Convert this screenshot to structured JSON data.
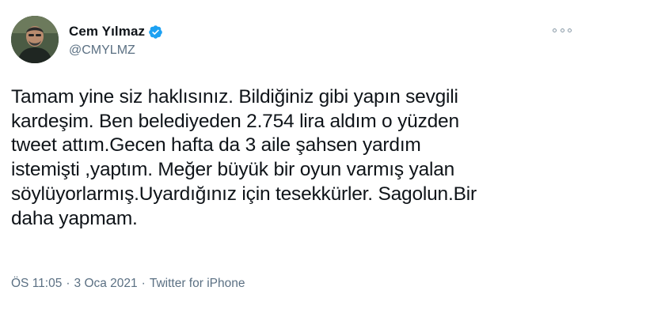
{
  "author": {
    "display_name": "Cem Yılmaz",
    "handle": "@CMYLMZ",
    "verified": true,
    "avatar_icon": "profile-photo"
  },
  "tweet": {
    "text": "Tamam yine siz haklısınız. Bildiğiniz gibi yapın sevgili\nkardeşim. Ben belediyeden 2.754 lira aldım o yüzden\ntweet attım.Gecen hafta da 3  aile şahsen yardım\nistemişti ,yaptım. Meğer büyük bir oyun varmış yalan\nsöylüyorlarmış.Uyardığınız için tesekkürler. Sagolun.Bir\ndaha yapmam.",
    "time": "ÖS 11:05",
    "date": "3 Oca 2021",
    "source": "Twitter for iPhone",
    "separator": "·"
  },
  "colors": {
    "text": "#0f1419",
    "secondary": "#5b7083",
    "verified_badge": "#1da1f2"
  },
  "icons": {
    "more": "more-options-icon",
    "verified": "verified-badge-icon"
  }
}
